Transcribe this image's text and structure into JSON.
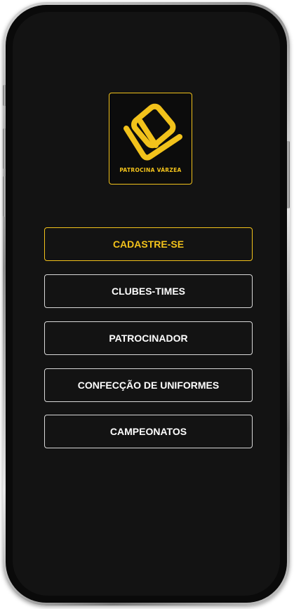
{
  "brand": {
    "name": "PATROCINA VÁRZEA",
    "accent_color": "#f2c21b",
    "logo_icon": "pv-monogram-logo"
  },
  "menu": {
    "items": [
      {
        "label": "CADASTRE-SE",
        "style": "primary"
      },
      {
        "label": "CLUBES-TIMES",
        "style": "outline"
      },
      {
        "label": "PATROCINADOR",
        "style": "outline"
      },
      {
        "label": "CONFECÇÃO DE UNIFORMES",
        "style": "outline"
      },
      {
        "label": "CAMPEONATOS",
        "style": "outline"
      }
    ]
  }
}
